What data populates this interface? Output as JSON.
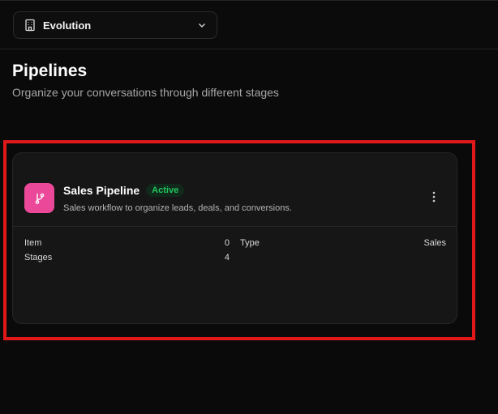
{
  "workspace": {
    "name": "Evolution",
    "icon": "building-icon",
    "chevron": "chevron-down-icon"
  },
  "page": {
    "title": "Pipelines",
    "subtitle": "Organize your conversations through different stages"
  },
  "pipeline": {
    "name": "Sales Pipeline",
    "status": "Active",
    "description": "Sales workflow to organize leads, deals, and conversions.",
    "icon": "git-branch-icon",
    "stats": [
      {
        "label": "Item",
        "value": "0"
      },
      {
        "label": "Stages",
        "value": "4"
      }
    ],
    "meta": [
      {
        "label": "Type",
        "value": "Sales"
      }
    ]
  },
  "colors": {
    "accent": "#ec4899",
    "active": "#22c55e",
    "highlight": "#e0181a"
  }
}
